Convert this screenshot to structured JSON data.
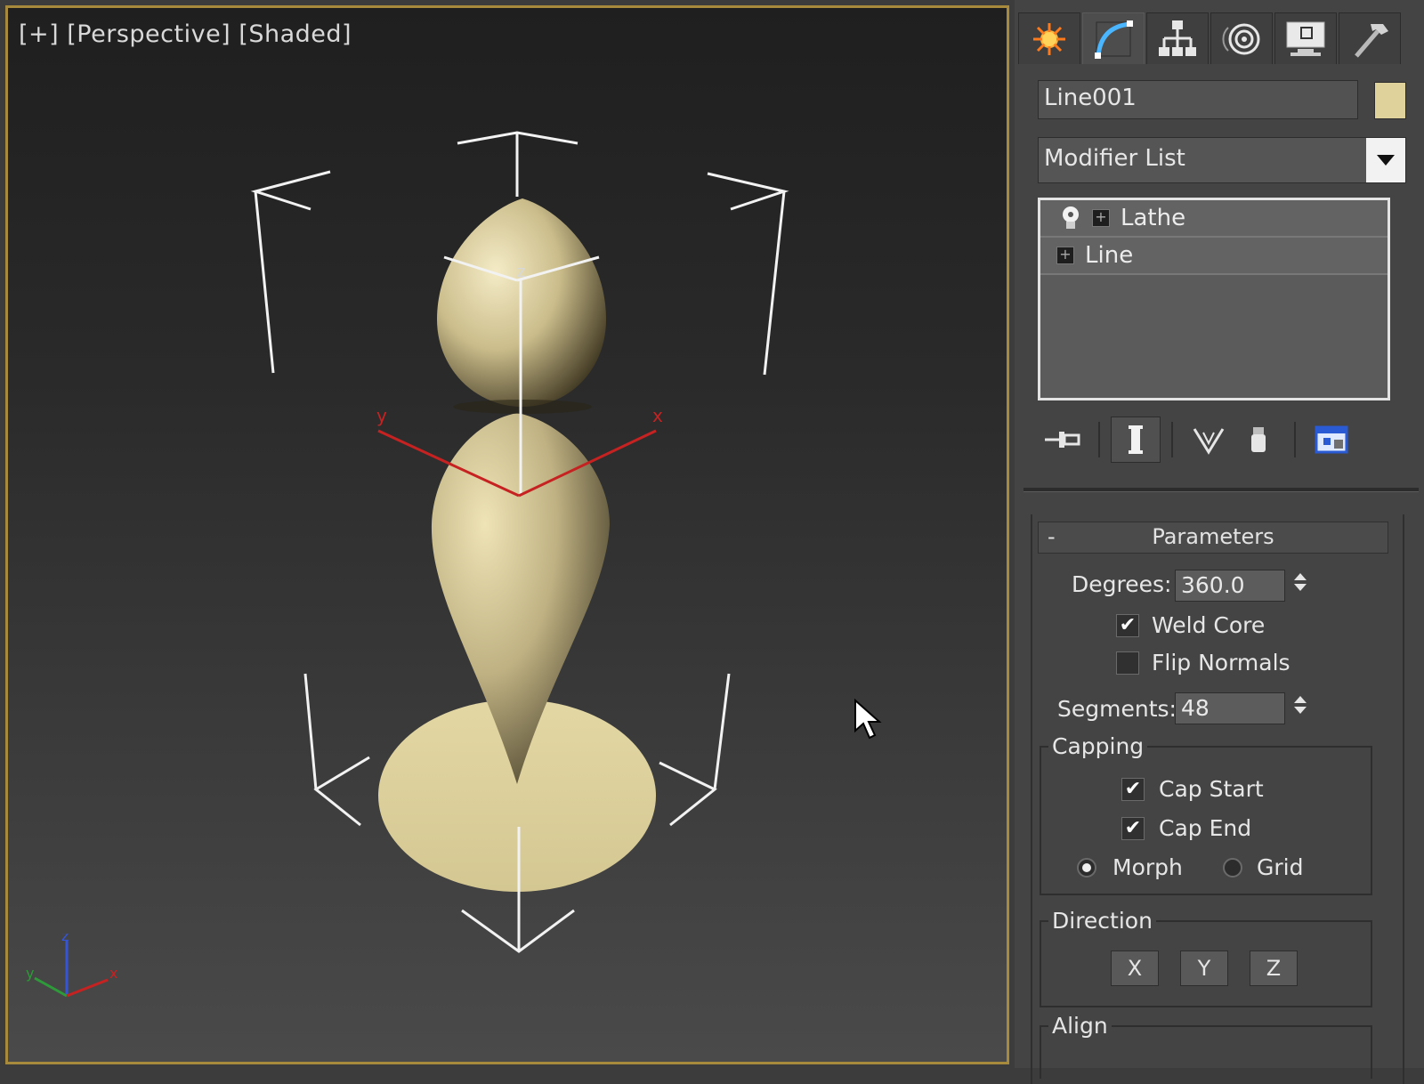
{
  "viewport": {
    "label": "[+] [Perspective] [Shaded]",
    "axis_labels": {
      "z": "z",
      "y": "y",
      "x": "x"
    }
  },
  "command_panel": {
    "tabs": [
      {
        "name": "create-tab",
        "icon": "sun-star-icon"
      },
      {
        "name": "modify-tab",
        "icon": "modify-curve-icon",
        "active": true
      },
      {
        "name": "hierarchy-tab",
        "icon": "hierarchy-icon"
      },
      {
        "name": "motion-tab",
        "icon": "motion-circle-icon"
      },
      {
        "name": "display-tab",
        "icon": "monitor-icon"
      },
      {
        "name": "utilities-tab",
        "icon": "hammer-icon"
      }
    ],
    "object_name": "Line001",
    "object_color": "#dfd29a",
    "modifier_list_label": "Modifier List",
    "stack": [
      {
        "label": "Lathe"
      },
      {
        "label": "Line"
      }
    ],
    "parameters": {
      "title": "Parameters",
      "collapse_symbol": "-",
      "degrees_label": "Degrees:",
      "degrees_value": "360.0",
      "weld_core_label": "Weld Core",
      "weld_core_checked": true,
      "flip_normals_label": "Flip Normals",
      "flip_normals_checked": false,
      "segments_label": "Segments:",
      "segments_value": "48",
      "capping": {
        "title": "Capping",
        "cap_start_label": "Cap Start",
        "cap_start_checked": true,
        "cap_end_label": "Cap End",
        "cap_end_checked": true,
        "morph_label": "Morph",
        "grid_label": "Grid",
        "selected": "Morph"
      },
      "direction": {
        "title": "Direction",
        "x": "X",
        "y": "Y",
        "z": "Z"
      },
      "align_title": "Align"
    }
  }
}
